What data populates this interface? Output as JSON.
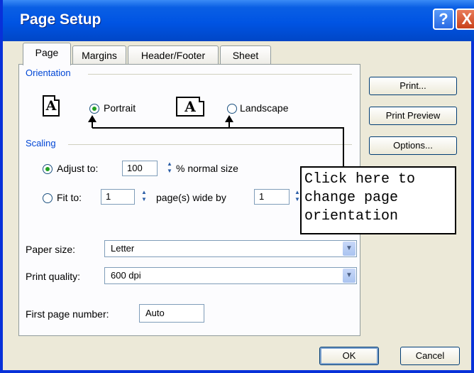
{
  "window": {
    "title": "Page Setup",
    "help_glyph": "?",
    "close_glyph": "X"
  },
  "tabs": [
    {
      "label": "Page",
      "active": true
    },
    {
      "label": "Margins"
    },
    {
      "label": "Header/Footer"
    },
    {
      "label": "Sheet"
    }
  ],
  "orientation": {
    "group_label": "Orientation",
    "portrait_label": "Portrait",
    "landscape_label": "Landscape",
    "portrait_icon_letter": "A",
    "landscape_icon_letter": "A",
    "selected": "Portrait"
  },
  "scaling": {
    "group_label": "Scaling",
    "adjust_label": "Adjust to:",
    "adjust_value": "100",
    "adjust_suffix": "% normal size",
    "fit_label": "Fit to:",
    "fit_wide_value": "1",
    "fit_wide_suffix": "page(s) wide by",
    "fit_tall_value": "1",
    "selected": "Adjust to"
  },
  "paper_size": {
    "label": "Paper size:",
    "value": "Letter"
  },
  "print_quality": {
    "label": "Print quality:",
    "value": "600 dpi"
  },
  "first_page_number": {
    "label": "First page number:",
    "value": "Auto"
  },
  "side_buttons": {
    "print": "Print...",
    "print_preview": "Print Preview",
    "options": "Options..."
  },
  "footer_buttons": {
    "ok": "OK",
    "cancel": "Cancel"
  },
  "callout": {
    "text": "Click here to\nchange page\norientation"
  },
  "colors": {
    "title_bar": "#0054e3",
    "dialog_bg": "#ece9d8",
    "group_label": "#0046d5",
    "radio_dot": "#21a121"
  }
}
